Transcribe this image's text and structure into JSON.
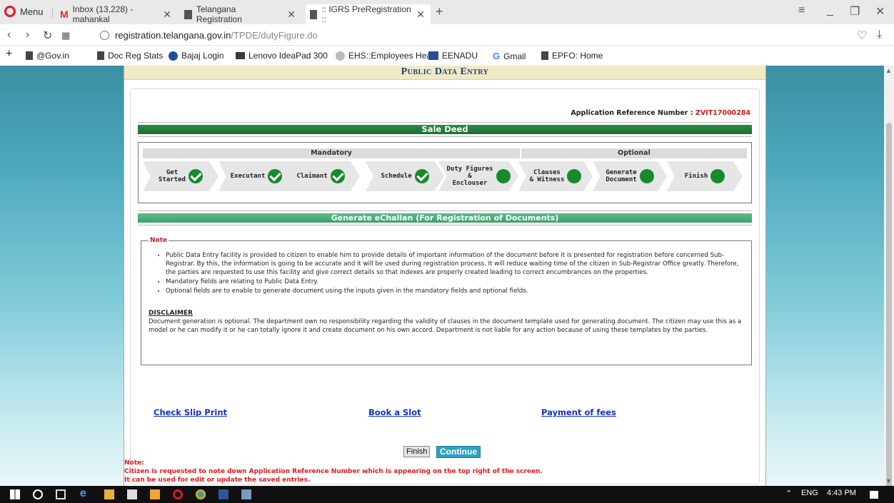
{
  "browser": {
    "menu_label": "Menu",
    "tabs": [
      {
        "title": "Inbox (13,228) - mahankal"
      },
      {
        "title": "Telangana Registration"
      },
      {
        "title": ":: IGRS PreRegistration ::"
      }
    ],
    "new_tab": "+",
    "url_host": "registration.telangana.gov.in",
    "url_path": "/TPDE/dutyFigure.do",
    "bookmarks": [
      {
        "label": "@Gov.in"
      },
      {
        "label": "Doc Reg Stats"
      },
      {
        "label": "Bajaj Login"
      },
      {
        "label": "Lenovo IdeaPad 300"
      },
      {
        "label": "EHS::Employees Hea"
      },
      {
        "label": "EENADU"
      },
      {
        "label": "Gmail"
      },
      {
        "label": "EPFO: Home"
      }
    ]
  },
  "page": {
    "header_title": "Public Data Entry",
    "ref_label": "Application Reference Number  : ",
    "ref_number": "ZVIT17000284",
    "deed_title": "Sale Deed",
    "mandatory_label": "Mandatory",
    "optional_label": "Optional",
    "steps": [
      {
        "label": "Get\nStarted",
        "done": true
      },
      {
        "label": "Executant",
        "done": true
      },
      {
        "label": "Claimant",
        "done": true
      },
      {
        "label": "Schedule",
        "done": true
      },
      {
        "label": "Duty Figures\n&\nEnclouser",
        "done": false
      },
      {
        "label": "Clauses\n& Witness",
        "done": false
      },
      {
        "label": "Generate\nDocument",
        "done": false
      },
      {
        "label": "Finish",
        "done": false
      }
    ],
    "echallan_title": "Generate eChallan (For Registration of Documents)",
    "note_legend": "Note",
    "note_items": [
      "Public Data Entry facility is provided to citizen to enable him to provide details of important information of the document before it is presented for registration before concerned Sub-Registrar. By this, the information is going to be accurate and it will be used during registration process. It will reduce waiting time of the citizen in Sub-Registrar Office greatly. Therefore, the parties are requested to use this facility and give correct details so that indexes are properly created leading to correct encumbrances on the properties.",
      "Mandatory fields are relating to Public Data Entry.",
      "Optional fields are to enable to generate document using the inputs given in the mandatory fields and optional fields."
    ],
    "disclaimer_title": "DISCLAIMER",
    "disclaimer_text": "Document generation is optional. The department own no responsibility regarding the validity of clauses in the document template used for generating document. The citizen may use this as a model or he can modify it or he can totally ignore it and create document on his own accord. Department is not liable for any action because of using these templates by the parties.",
    "links": {
      "check_slip": "Check Slip Print",
      "book_slot": "Book a Slot",
      "payment": "Payment of fees"
    },
    "finish_label": "Finish",
    "continue_label": "Continue",
    "bottom_note_title": "Note:",
    "bottom_note_line1": "Citizen is requested to note down Application Reference Number which is appearing on the top right of the screen.",
    "bottom_note_line2": "It can be used for edit or update the saved entries."
  },
  "taskbar": {
    "language": "ENG",
    "time": "4:43 PM"
  },
  "colors": {
    "deed_bar": "#1f6e35",
    "echallan_bar": "#3ea06c",
    "step_done": "#168a2c",
    "link": "#1430c9",
    "ref_number": "#d31a1a",
    "continue_button": "#2fa0c0"
  }
}
